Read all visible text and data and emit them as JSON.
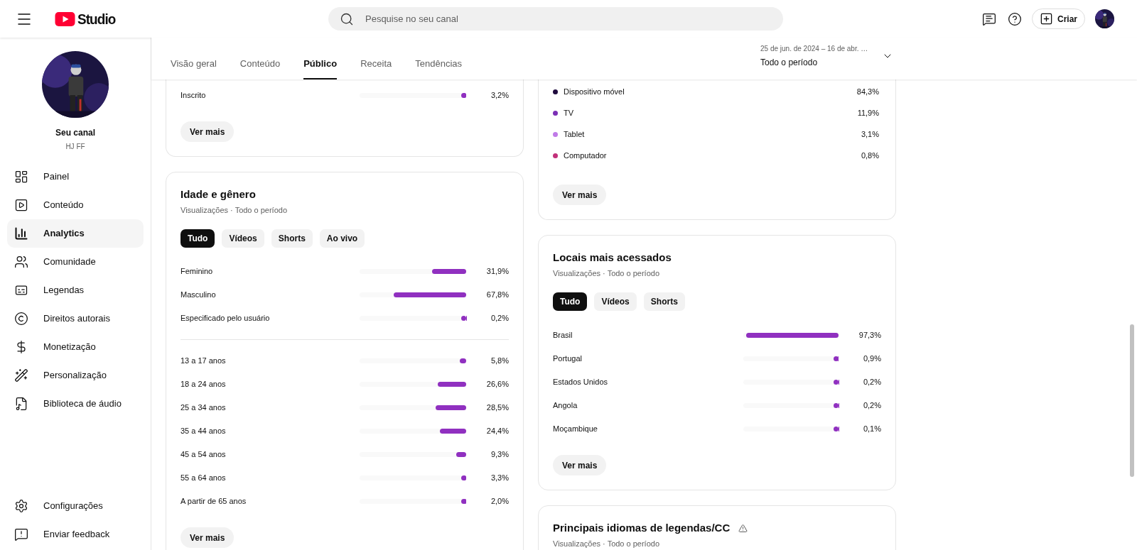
{
  "header": {
    "logo_text": "Studio",
    "search": {
      "placeholder": "Pesquise no seu canal"
    },
    "create_button": "Criar"
  },
  "sidebar": {
    "channel_title": "Seu canal",
    "channel_handle": "HJ FF",
    "nav": [
      {
        "label": "Painel",
        "selected": false
      },
      {
        "label": "Conteúdo",
        "selected": false
      },
      {
        "label": "Analytics",
        "selected": true
      },
      {
        "label": "Comunidade",
        "selected": false
      },
      {
        "label": "Legendas",
        "selected": false
      },
      {
        "label": "Direitos autorais",
        "selected": false
      },
      {
        "label": "Monetização",
        "selected": false
      },
      {
        "label": "Personalização",
        "selected": false
      },
      {
        "label": "Biblioteca de áudio",
        "selected": false
      }
    ],
    "footer": [
      {
        "label": "Configurações"
      },
      {
        "label": "Enviar feedback"
      }
    ]
  },
  "tabs": [
    {
      "label": "Visão geral",
      "selected": false
    },
    {
      "label": "Conteúdo",
      "selected": false
    },
    {
      "label": "Público",
      "selected": true
    },
    {
      "label": "Receita",
      "selected": false
    },
    {
      "label": "Tendências",
      "selected": false
    }
  ],
  "date_range": {
    "range": "25 de jun. de 2024 – 16 de abr. …",
    "period": "Todo o período"
  },
  "left_column": {
    "subscription_card": {
      "rows": [
        {
          "label": "Inscrito",
          "level": 0.032,
          "value": "3,2%"
        }
      ],
      "button": "Ver mais"
    },
    "age_gender_card": {
      "title": "Idade e gênero",
      "subtitle": "Visualizações · Todo o período",
      "filters": [
        {
          "label": "Tudo",
          "selected": true
        },
        {
          "label": "Vídeos",
          "selected": false
        },
        {
          "label": "Shorts",
          "selected": false
        },
        {
          "label": "Ao vivo",
          "selected": false
        }
      ],
      "gender_rows": [
        {
          "label": "Feminino",
          "level": 0.319,
          "value": "31,9%"
        },
        {
          "label": "Masculino",
          "level": 0.678,
          "value": "67,8%"
        },
        {
          "label": "Especificado pelo usuário",
          "level": 0.002,
          "value": "0,2%"
        }
      ],
      "age_rows": [
        {
          "label": "13 a 17 anos",
          "level": 0.058,
          "value": "5,8%"
        },
        {
          "label": "18 a 24 anos",
          "level": 0.266,
          "value": "26,6%"
        },
        {
          "label": "25 a 34 anos",
          "level": 0.285,
          "value": "28,5%"
        },
        {
          "label": "35 a 44 anos",
          "level": 0.244,
          "value": "24,4%"
        },
        {
          "label": "45 a 54 anos",
          "level": 0.093,
          "value": "9,3%"
        },
        {
          "label": "55 a 64 anos",
          "level": 0.033,
          "value": "3,3%"
        },
        {
          "label": "A partir de 65 anos",
          "level": 0.02,
          "value": "2,0%"
        }
      ],
      "button": "Ver mais"
    }
  },
  "right_column": {
    "device_card": {
      "rows": [
        {
          "label": "Dispositivo móvel",
          "color": "#1f0a3d",
          "value": "84,3%"
        },
        {
          "label": "TV",
          "color": "#7b2fb5",
          "value": "11,9%"
        },
        {
          "label": "Tablet",
          "color": "#c07ae8",
          "value": "3,1%"
        },
        {
          "label": "Computador",
          "color": "#c2307a",
          "value": "0,8%"
        }
      ],
      "button": "Ver mais"
    },
    "locations_card": {
      "title": "Locais mais acessados",
      "subtitle": "Visualizações · Todo o período",
      "filters": [
        {
          "label": "Tudo",
          "selected": true
        },
        {
          "label": "Vídeos",
          "selected": false
        },
        {
          "label": "Shorts",
          "selected": false
        }
      ],
      "rows": [
        {
          "label": "Brasil",
          "level": 0.973,
          "value": "97,3%"
        },
        {
          "label": "Portugal",
          "level": 0.009,
          "value": "0,9%"
        },
        {
          "label": "Estados Unidos",
          "level": 0.002,
          "value": "0,2%"
        },
        {
          "label": "Angola",
          "level": 0.002,
          "value": "0,2%"
        },
        {
          "label": "Moçambique",
          "level": 0.001,
          "value": "0,1%"
        }
      ],
      "button": "Ver mais"
    },
    "captions_card": {
      "title": "Principais idiomas de legendas/CC",
      "subtitle": "Visualizações · Todo o período"
    }
  }
}
